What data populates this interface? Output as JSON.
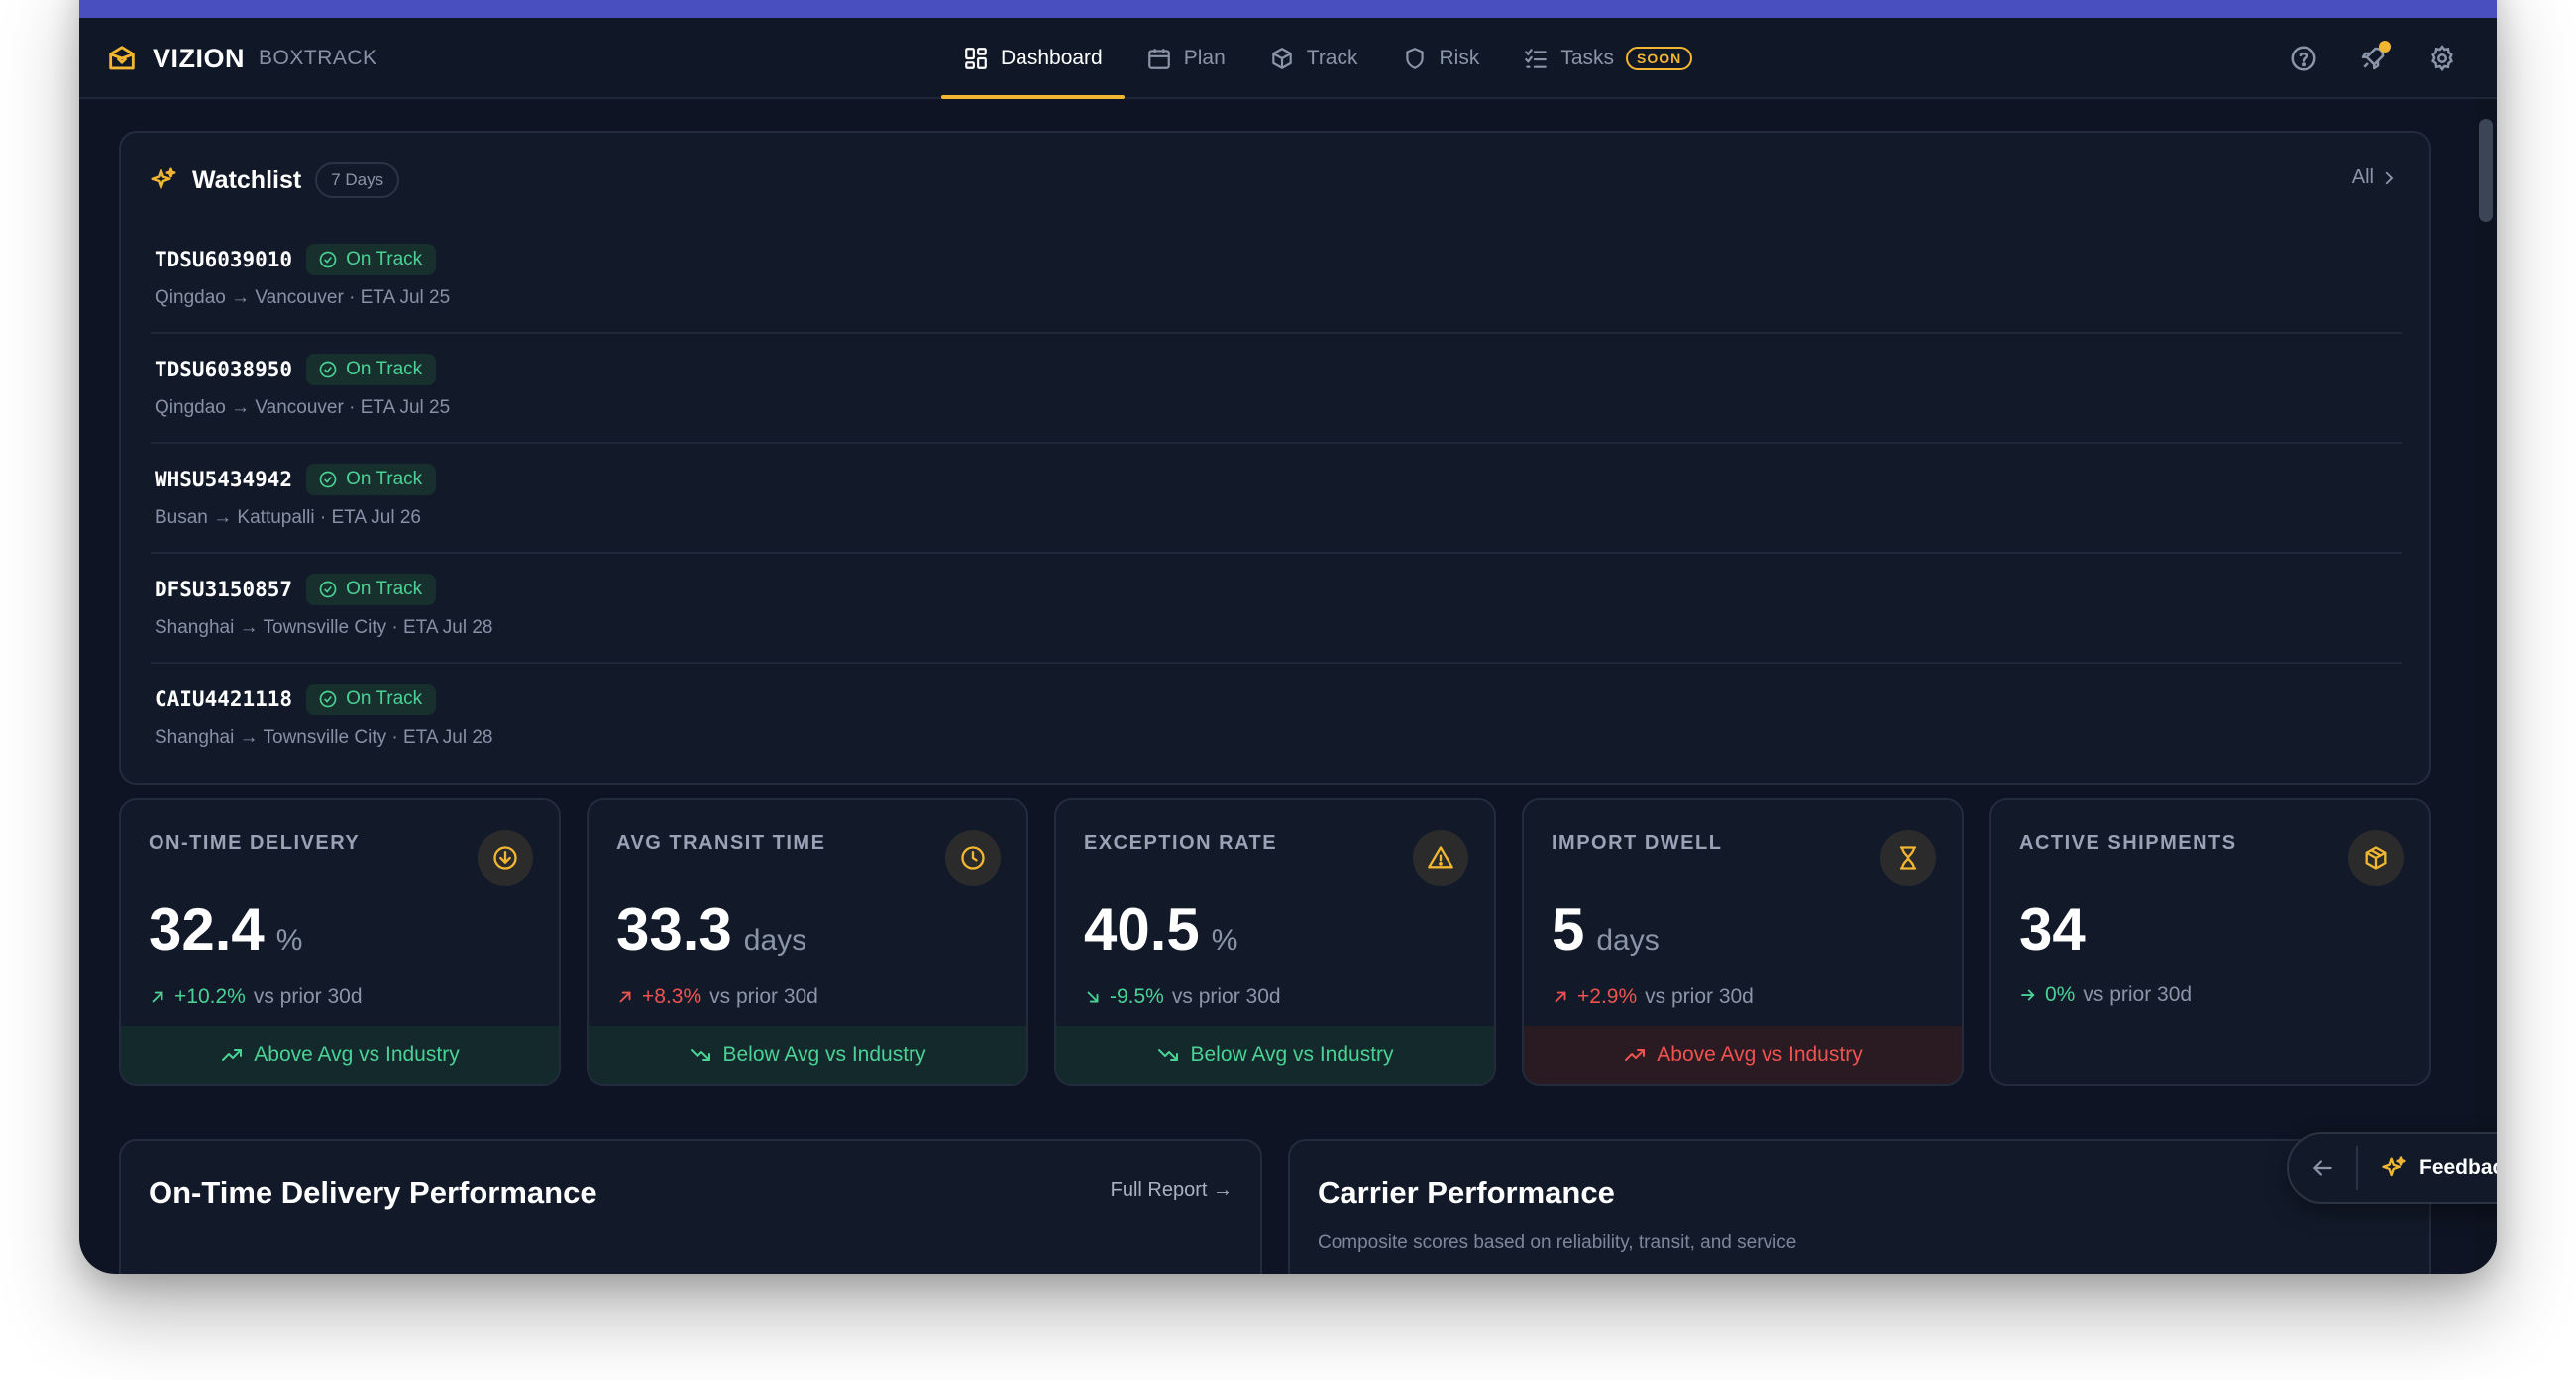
{
  "brand": {
    "name": "VIZION",
    "sub": "BOXTRACK"
  },
  "nav": {
    "tabs": [
      {
        "label": "Dashboard",
        "icon": "dashboard-icon",
        "active": true
      },
      {
        "label": "Plan",
        "icon": "calendar-icon"
      },
      {
        "label": "Track",
        "icon": "box-icon"
      },
      {
        "label": "Risk",
        "icon": "shield-icon"
      },
      {
        "label": "Tasks",
        "icon": "checklist-icon",
        "badge": "SOON"
      }
    ],
    "right_icons": [
      "help-icon",
      "rocket-icon",
      "gear-icon"
    ]
  },
  "watchlist": {
    "title": "Watchlist",
    "range": "7 Days",
    "all_label": "All",
    "items": [
      {
        "id": "TDSU6039010",
        "status": "On Track",
        "route": "Qingdao → Vancouver · ETA Jul 25"
      },
      {
        "id": "TDSU6038950",
        "status": "On Track",
        "route": "Qingdao → Vancouver · ETA Jul 25"
      },
      {
        "id": "WHSU5434942",
        "status": "On Track",
        "route": "Busan → Kattupalli · ETA Jul 26"
      },
      {
        "id": "DFSU3150857",
        "status": "On Track",
        "route": "Shanghai → Townsville City · ETA Jul 28"
      },
      {
        "id": "CAIU4421118",
        "status": "On Track",
        "route": "Shanghai → Townsville City · ETA Jul 28"
      }
    ]
  },
  "kpis": [
    {
      "label": "ON-TIME DELIVERY",
      "icon": "arrow-down-circle-icon",
      "value": "32.4",
      "unit": "%",
      "delta": "+10.2%",
      "delta_dir": "up",
      "delta_tone": "good",
      "delta_sub": "vs prior 30d",
      "foot": "Above Avg vs Industry",
      "foot_tone": "good",
      "foot_icon": "trend-up-icon"
    },
    {
      "label": "AVG TRANSIT TIME",
      "icon": "clock-icon",
      "value": "33.3",
      "unit": "days",
      "delta": "+8.3%",
      "delta_dir": "up",
      "delta_tone": "bad",
      "delta_sub": "vs prior 30d",
      "foot": "Below Avg vs Industry",
      "foot_tone": "good",
      "foot_icon": "trend-down-icon"
    },
    {
      "label": "EXCEPTION RATE",
      "icon": "warning-icon",
      "value": "40.5",
      "unit": "%",
      "delta": "-9.5%",
      "delta_dir": "down",
      "delta_tone": "good",
      "delta_sub": "vs prior 30d",
      "foot": "Below Avg vs Industry",
      "foot_tone": "good",
      "foot_icon": "trend-down-icon"
    },
    {
      "label": "IMPORT DWELL",
      "icon": "hourglass-icon",
      "value": "5",
      "unit": "days",
      "delta": "+2.9%",
      "delta_dir": "up",
      "delta_tone": "bad",
      "delta_sub": "vs prior 30d",
      "foot": "Above Avg vs Industry",
      "foot_tone": "bad",
      "foot_icon": "trend-up-icon"
    },
    {
      "label": "ACTIVE SHIPMENTS",
      "icon": "box-icon",
      "value": "34",
      "unit": "",
      "delta": "0%",
      "delta_dir": "flat",
      "delta_tone": "good",
      "delta_sub": "vs prior 30d",
      "foot": "",
      "foot_tone": "",
      "foot_icon": ""
    }
  ],
  "panels": {
    "otd": {
      "title": "On-Time Delivery Performance",
      "link": "Full Report →"
    },
    "carrier": {
      "title": "Carrier Performance",
      "subtitle": "Composite scores based on reliability, transit, and service"
    }
  },
  "feedback": {
    "label": "Feedback"
  },
  "colors": {
    "accent": "#f2b632",
    "good": "#4ad295",
    "bad": "#ef5350",
    "topbar": "#4a4fbf",
    "bg": "#0e1423"
  }
}
